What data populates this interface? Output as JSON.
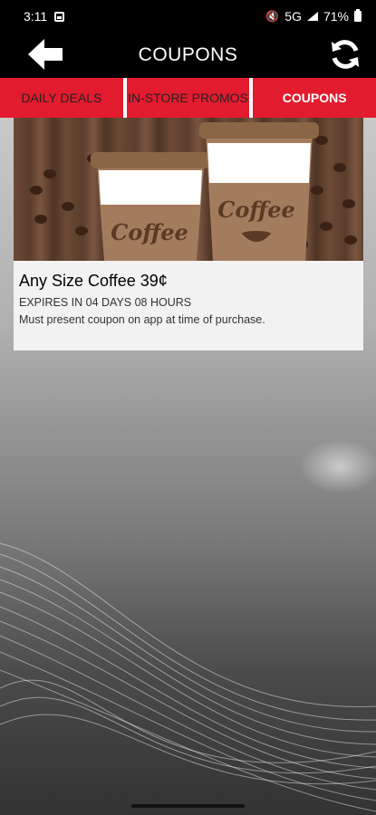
{
  "status_bar": {
    "time": "3:11",
    "network": "5G",
    "battery": "71%",
    "icons": [
      "gallery-icon",
      "mute-icon",
      "signal-icon",
      "battery-icon"
    ]
  },
  "header": {
    "title": "COUPONS",
    "back_icon": "back-arrow-icon",
    "refresh_icon": "refresh-icon"
  },
  "tabs": [
    {
      "label": "DAILY DEALS",
      "active": false
    },
    {
      "label": "IN-STORE PROMOS",
      "active": false
    },
    {
      "label": "COUPONS",
      "active": true
    }
  ],
  "coupons": [
    {
      "title": "Any Size Coffee 39¢",
      "expiry": "EXPIRES IN 04 DAYS 08 HOURS",
      "terms": "Must present coupon on app at time of purchase.",
      "image": {
        "cup_label": "Coffee",
        "icons": [
          "coffee-cup-icon",
          "coffee-bean-icon"
        ]
      }
    }
  ],
  "colors": {
    "header_bg": "#000000",
    "tab_red": "#e31b2f",
    "card_bg": "#f2f2f2"
  }
}
